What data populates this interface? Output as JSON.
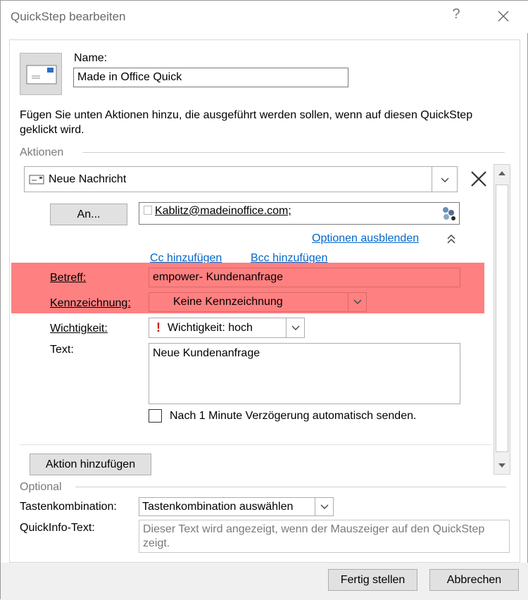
{
  "window": {
    "title": "QuickStep bearbeiten",
    "help": "?"
  },
  "name": {
    "label": "Name:",
    "value": "Made in Office Quick"
  },
  "intro_text": "Fügen Sie unten Aktionen hinzu, die ausgeführt werden sollen, wenn auf diesen QuickStep geklickt wird.",
  "actions": {
    "section_label": "Aktionen",
    "action_select": "Neue Nachricht",
    "to_button": "An...",
    "to_value": "Kablitz@madeinoffice.com;",
    "options_link": "Optionen ausblenden",
    "cc_link": "Cc hinzufügen",
    "bcc_link": "Bcc hinzufügen",
    "subject_label": "Betreff:",
    "subject_value": "empower- Kundenanfrage",
    "flag_label": "Kennzeichnung:",
    "flag_value": "Keine Kennzeichnung",
    "importance_label": "Wichtigkeit:",
    "importance_value": "Wichtigkeit: hoch",
    "text_label": "Text:",
    "text_value": "Neue Kundenanfrage",
    "autosend_label": "Nach 1 Minute Verzögerung automatisch senden.",
    "add_action_button": "Aktion hinzufügen",
    "highlight_color": "#ff8080"
  },
  "optional": {
    "section_label": "Optional",
    "shortcut_label": "Tastenkombination:",
    "shortcut_value": "Tastenkombination auswählen",
    "tooltip_label": "QuickInfo-Text:",
    "tooltip_value": "Dieser Text wird angezeigt, wenn der Mauszeiger auf den QuickStep zeigt."
  },
  "footer": {
    "finish_button": "Fertig stellen",
    "cancel_button": "Abbrechen"
  }
}
